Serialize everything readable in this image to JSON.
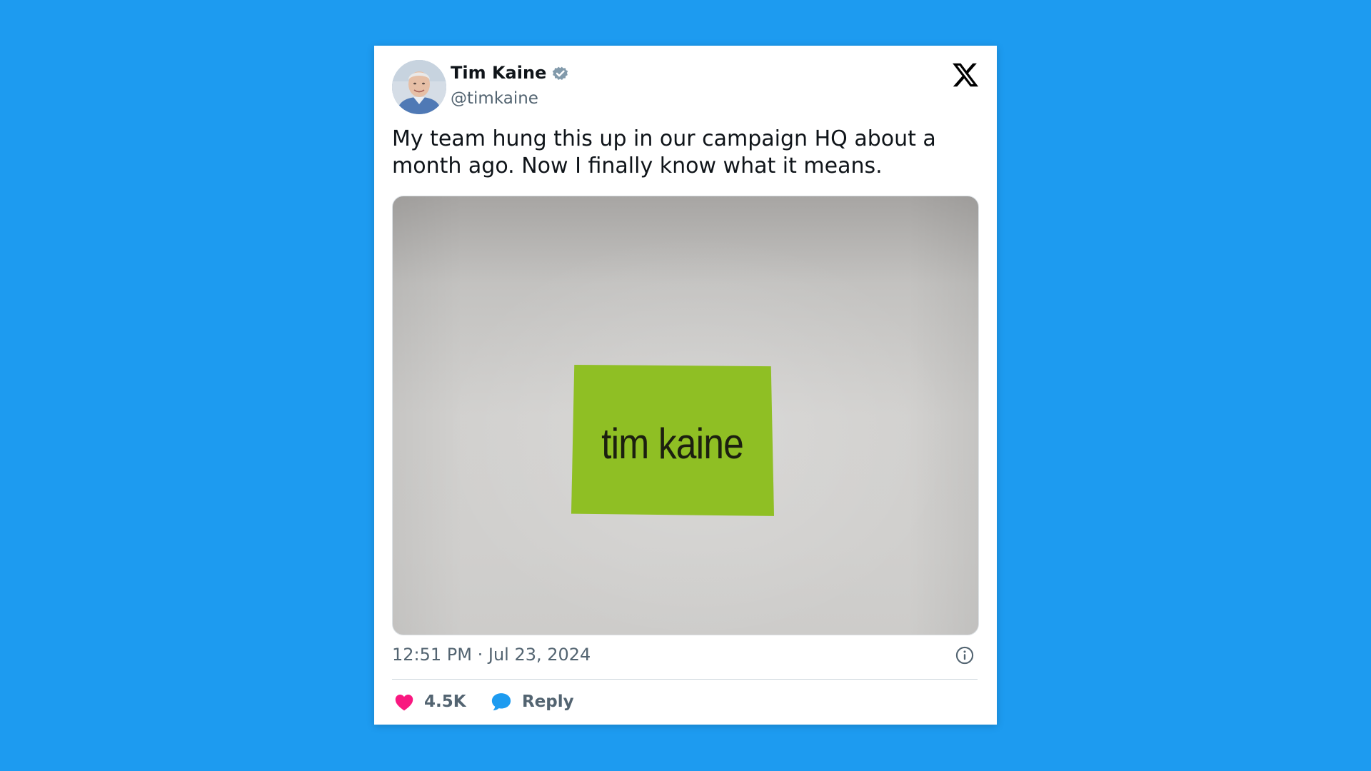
{
  "page": {
    "background_color": "#1d9bf0"
  },
  "tweet": {
    "author": {
      "name": "Tim Kaine",
      "handle": "@timkaine",
      "verified": true,
      "verified_badge_color": "#829aab"
    },
    "platform_logo": "x-logo-icon",
    "text": "My team hung this up in our campaign HQ about a month ago. Now I finally know what it means.",
    "media": {
      "sticky_note_text": "tim kaine",
      "sticky_note_color": "#8fbf24"
    },
    "timestamp": "12:51 PM · Jul 23, 2024",
    "actions": {
      "like_count": "4.5K",
      "like_color": "#f91880",
      "reply_label": "Reply",
      "reply_color": "#1d9bf0"
    }
  }
}
